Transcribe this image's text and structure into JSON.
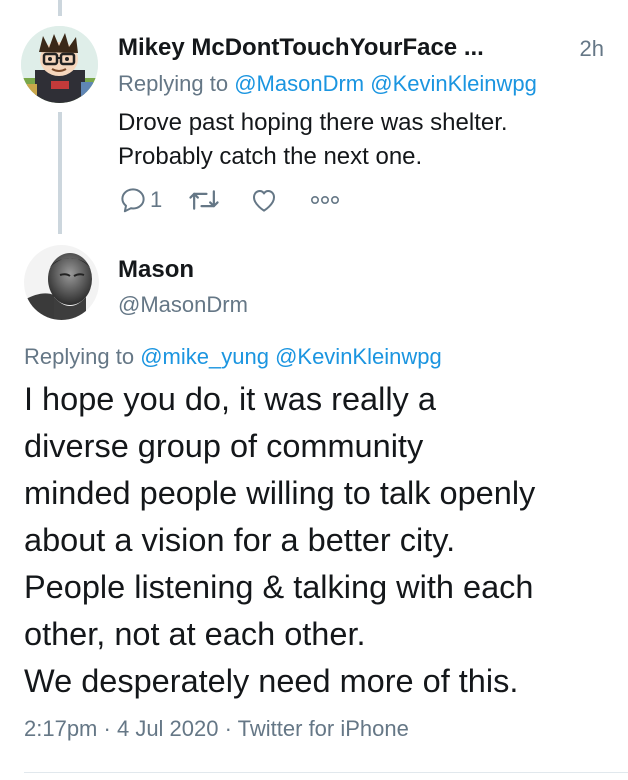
{
  "reply_tweet": {
    "display_name": "Mikey McDontTouchYourFace ...",
    "time": "2h",
    "replying_prefix": "Replying to",
    "mentions": [
      "@MasonDrm",
      "@KevinKleinwpg"
    ],
    "text_lines": [
      "Drove past hoping there was shelter.",
      "Probably catch the next one."
    ],
    "reply_count": "1",
    "icons": [
      "reply-icon",
      "retweet-icon",
      "like-icon",
      "more-icon"
    ]
  },
  "main_tweet": {
    "display_name": "Mason",
    "handle": "@MasonDrm",
    "replying_prefix": "Replying to",
    "mentions": [
      "@mike_yung",
      "@KevinKleinwpg"
    ],
    "text_lines": [
      "I hope you do, it was really a",
      "diverse group of community",
      "minded people willing to talk openly",
      "about a vision for a better city.",
      "People listening & talking with each",
      "other, not at each other.",
      "We desperately need more of this."
    ],
    "time": "2:17pm",
    "date": "4 Jul 2020",
    "source": "Twitter for iPhone",
    "separator": "·"
  },
  "colors": {
    "text": "#14171a",
    "secondary": "#657786",
    "link": "#1b95e0",
    "thread_line": "#ccd6dd"
  }
}
